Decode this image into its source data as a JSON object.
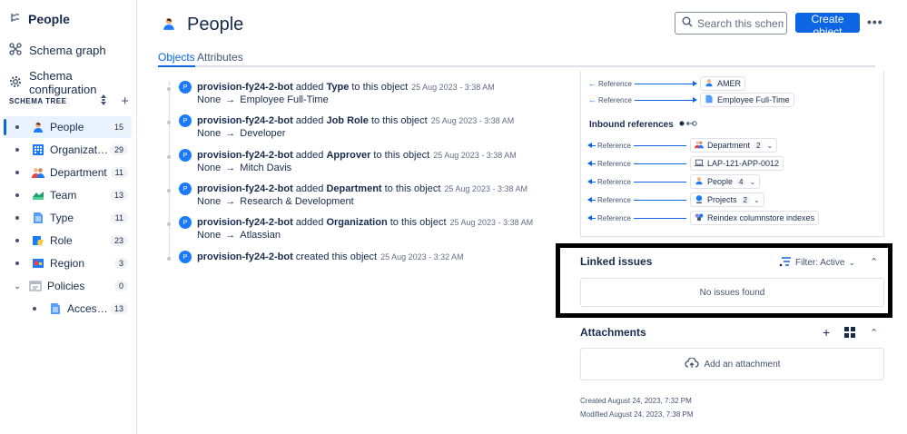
{
  "sidebar": {
    "title": "People",
    "links": [
      {
        "label": "Schema graph",
        "icon": "graph-icon"
      },
      {
        "label": "Schema configuration",
        "icon": "gear-icon"
      }
    ],
    "section_label": "SCHEMA TREE",
    "tree": [
      {
        "name": "People",
        "count": "15",
        "icon": "person-icon",
        "active": true
      },
      {
        "name": "Organization",
        "count": "29",
        "icon": "building-icon"
      },
      {
        "name": "Department",
        "count": "11",
        "icon": "group-icon"
      },
      {
        "name": "Team",
        "count": "13",
        "icon": "team-icon"
      },
      {
        "name": "Type",
        "count": "11",
        "icon": "document-icon"
      },
      {
        "name": "Role",
        "count": "23",
        "icon": "role-icon"
      },
      {
        "name": "Region",
        "count": "3",
        "icon": "map-icon"
      },
      {
        "name": "Policies",
        "count": "0",
        "icon": "policy-icon",
        "expanded": true
      },
      {
        "name": "Access P...",
        "count": "13",
        "icon": "document-icon",
        "child": true
      }
    ]
  },
  "header": {
    "title": "People",
    "search_placeholder": "Search this schema...",
    "create_label": "Create object",
    "more_label": "•••"
  },
  "tabs": [
    {
      "label": "Objects",
      "active": true
    },
    {
      "label": "Attributes"
    }
  ],
  "activity": [
    {
      "actor": "provision-fy24-2-bot",
      "verb": "added",
      "attr": "Type",
      "rest": "to this object",
      "time": "25 Aug 2023 - 3:38 AM",
      "from": "None",
      "to": "Employee Full-Time"
    },
    {
      "actor": "provision-fy24-2-bot",
      "verb": "added",
      "attr": "Job Role",
      "rest": "to this object",
      "time": "25 Aug 2023 - 3:38 AM",
      "from": "None",
      "to": "Developer"
    },
    {
      "actor": "provision-fy24-2-bot",
      "verb": "added",
      "attr": "Approver",
      "rest": "to this object",
      "time": "25 Aug 2023 - 3:38 AM",
      "from": "None",
      "to": "Mitch Davis"
    },
    {
      "actor": "provision-fy24-2-bot",
      "verb": "added",
      "attr": "Department",
      "rest": "to this object",
      "time": "25 Aug 2023 - 3:38 AM",
      "from": "None",
      "to": "Research & Development"
    },
    {
      "actor": "provision-fy24-2-bot",
      "verb": "added",
      "attr": "Organization",
      "rest": "to this object",
      "time": "25 Aug 2023 - 3:38 AM",
      "from": "None",
      "to": "Atlassian"
    },
    {
      "actor": "provision-fy24-2-bot",
      "verb": "created this object",
      "attr": "",
      "rest": "",
      "time": "25 Aug 2023 - 3:32 AM",
      "from": "",
      "to": ""
    }
  ],
  "avatar_letter": "P",
  "outbound_refs": [
    {
      "label": "Reference",
      "target": "AMER",
      "icon": "person-icon"
    },
    {
      "label": "Reference",
      "target": "Employee Full-Time",
      "icon": "document-icon"
    }
  ],
  "inbound_title": "Inbound references",
  "inbound_refs": [
    {
      "label": "Reference",
      "target": "Department",
      "count": "2",
      "dropdown": true,
      "icon": "group-icon"
    },
    {
      "label": "Reference",
      "target": "LAP-121-APP-0012",
      "icon": "laptop-icon"
    },
    {
      "label": "Reference",
      "target": "People",
      "count": "4",
      "dropdown": true,
      "icon": "person-icon"
    },
    {
      "label": "Reference",
      "target": "Projects",
      "count": "2",
      "dropdown": true,
      "icon": "project-icon"
    },
    {
      "label": "Reference",
      "target": "Reindex columnstore indexes",
      "icon": "task-icon"
    }
  ],
  "linked_issues": {
    "title": "Linked issues",
    "filter": "Filter: Active",
    "empty": "No issues found"
  },
  "attachments": {
    "title": "Attachments",
    "add_label": "Add an attachment"
  },
  "meta": {
    "created": "Created August 24, 2023, 7:32 PM",
    "modified": "Modified August 24, 2023, 7:38 PM"
  },
  "colors": {
    "accent": "#0c66e4",
    "avatar": "#1d7afc",
    "frame": "#000000"
  }
}
